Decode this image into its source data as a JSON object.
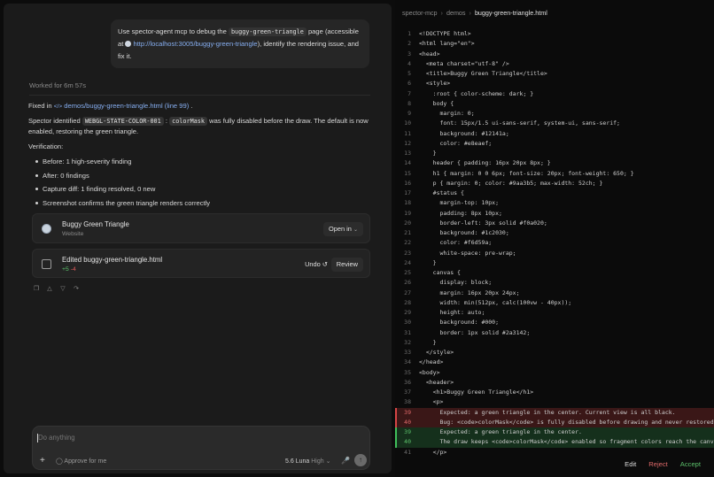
{
  "chat": {
    "user_message": {
      "prefix": "Use spector-agent mcp to debug the",
      "page_code": "buggy-green-triangle",
      "middle": "page (accessible at",
      "url": "http://localhost:3005/buggy-green-triangle",
      "suffix": "), identify the rendering issue, and fix it."
    },
    "worked_for": "Worked for 6m 57s",
    "fixed_in_prefix": "Fixed in",
    "fixed_in_link": "demos/buggy-green-triangle.html (line 99)",
    "fixed_in_suffix": ".",
    "identified": {
      "prefix": "Spector identified",
      "code1": "WEBGL-STATE-COLOR-001",
      "colon": ":",
      "code2": "colorMask",
      "suffix": "was fully disabled before the draw. The default is now enabled, restoring the green triangle."
    },
    "verification_label": "Verification:",
    "bullets": [
      "Before: 1 high-severity finding",
      "After: 0 findings",
      "Capture diff: 1 finding resolved, 0 new",
      "Screenshot confirms the green triangle renders correctly"
    ],
    "website_card": {
      "title": "Buggy Green Triangle",
      "subtitle": "Website",
      "open_label": "Open in"
    },
    "edit_card": {
      "title": "Edited buggy-green-triangle.html",
      "added": "+5",
      "removed": "-4",
      "undo_label": "Undo",
      "review_label": "Review"
    },
    "composer": {
      "placeholder": "Do anything",
      "approve_label": "Approve for me",
      "model": "5.6 Luna",
      "effort": "High"
    }
  },
  "editor": {
    "breadcrumb": [
      "spector-mcp",
      "demos",
      "buggy-green-triangle.html"
    ],
    "lines": [
      {
        "n": "1",
        "text": "<!DOCTYPE html>",
        "kind": "normal"
      },
      {
        "n": "2",
        "text": "<html lang=\"en\">",
        "kind": "normal"
      },
      {
        "n": "3",
        "text": "<head>",
        "kind": "normal"
      },
      {
        "n": "4",
        "text": "  <meta charset=\"utf-8\" />",
        "kind": "normal"
      },
      {
        "n": "5",
        "text": "  <title>Buggy Green Triangle</title>",
        "kind": "normal"
      },
      {
        "n": "6",
        "text": "  <style>",
        "kind": "normal"
      },
      {
        "n": "7",
        "text": "    :root { color-scheme: dark; }",
        "kind": "normal"
      },
      {
        "n": "8",
        "text": "    body {",
        "kind": "normal"
      },
      {
        "n": "9",
        "text": "      margin: 0;",
        "kind": "normal"
      },
      {
        "n": "10",
        "text": "      font: 15px/1.5 ui-sans-serif, system-ui, sans-serif;",
        "kind": "normal"
      },
      {
        "n": "11",
        "text": "      background: #12141a;",
        "kind": "normal"
      },
      {
        "n": "12",
        "text": "      color: #e8eaef;",
        "kind": "normal"
      },
      {
        "n": "13",
        "text": "    }",
        "kind": "normal"
      },
      {
        "n": "14",
        "text": "    header { padding: 16px 20px 8px; }",
        "kind": "normal"
      },
      {
        "n": "15",
        "text": "    h1 { margin: 0 0 6px; font-size: 20px; font-weight: 650; }",
        "kind": "normal"
      },
      {
        "n": "16",
        "text": "    p { margin: 0; color: #9aa3b5; max-width: 52ch; }",
        "kind": "normal"
      },
      {
        "n": "17",
        "text": "    #status {",
        "kind": "normal"
      },
      {
        "n": "18",
        "text": "      margin-top: 10px;",
        "kind": "normal"
      },
      {
        "n": "19",
        "text": "      padding: 8px 10px;",
        "kind": "normal"
      },
      {
        "n": "20",
        "text": "      border-left: 3px solid #f0a020;",
        "kind": "normal"
      },
      {
        "n": "21",
        "text": "      background: #1c2030;",
        "kind": "normal"
      },
      {
        "n": "22",
        "text": "      color: #f6d59a;",
        "kind": "normal"
      },
      {
        "n": "23",
        "text": "      white-space: pre-wrap;",
        "kind": "normal"
      },
      {
        "n": "24",
        "text": "    }",
        "kind": "normal"
      },
      {
        "n": "25",
        "text": "    canvas {",
        "kind": "normal"
      },
      {
        "n": "26",
        "text": "      display: block;",
        "kind": "normal"
      },
      {
        "n": "27",
        "text": "      margin: 16px 20px 24px;",
        "kind": "normal"
      },
      {
        "n": "28",
        "text": "      width: min(512px, calc(100vw - 40px));",
        "kind": "normal"
      },
      {
        "n": "29",
        "text": "      height: auto;",
        "kind": "normal"
      },
      {
        "n": "30",
        "text": "      background: #000;",
        "kind": "normal"
      },
      {
        "n": "31",
        "text": "      border: 1px solid #2a3142;",
        "kind": "normal"
      },
      {
        "n": "32",
        "text": "    }",
        "kind": "normal"
      },
      {
        "n": "33",
        "text": "  </style>",
        "kind": "normal"
      },
      {
        "n": "34",
        "text": "</head>",
        "kind": "normal"
      },
      {
        "n": "35",
        "text": "<body>",
        "kind": "normal"
      },
      {
        "n": "36",
        "text": "  <header>",
        "kind": "normal"
      },
      {
        "n": "37",
        "text": "    <h1>Buggy Green Triangle</h1>",
        "kind": "normal"
      },
      {
        "n": "38",
        "text": "    <p>",
        "kind": "normal"
      },
      {
        "n": "39",
        "text": "      Expected: a green triangle in the center. Current view is all black.",
        "kind": "del"
      },
      {
        "n": "40",
        "text": "      Bug: <code>colorMask</code> is fully disabled before drawing and never restored",
        "kind": "del"
      },
      {
        "n": "39",
        "text": "      Expected: a green triangle in the center.",
        "kind": "add"
      },
      {
        "n": "40",
        "text": "      The draw keeps <code>colorMask</code> enabled so fragment colors reach the canv",
        "kind": "add"
      },
      {
        "n": "41",
        "text": "    </p>",
        "kind": "normal"
      }
    ],
    "actions": {
      "edit": "Edit",
      "reject": "Reject",
      "accept": "Accept"
    }
  },
  "colors": {
    "added": "#5cc16b",
    "removed": "#e06a6a",
    "link": "#86aef0"
  }
}
